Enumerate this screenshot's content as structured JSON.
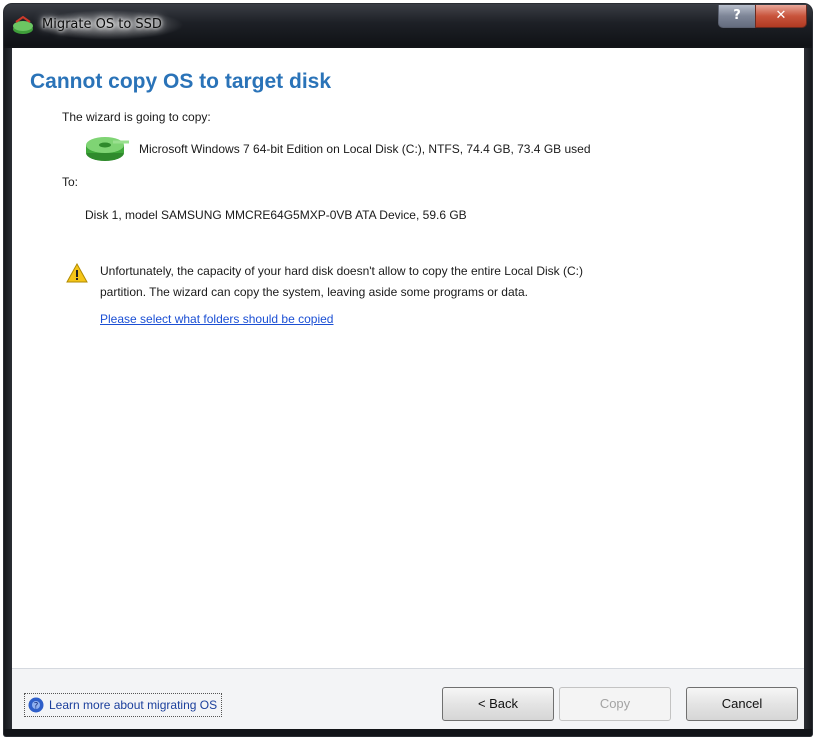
{
  "window": {
    "title": "Migrate OS to SSD",
    "help_label": "?",
    "close_label": "✕"
  },
  "content": {
    "heading": "Cannot copy OS to target disk",
    "intro": "The wizard is going to copy:",
    "source": "Microsoft Windows 7 64-bit Edition on Local Disk (C:), NTFS, 74.4 GB, 73.4 GB used",
    "to_label": "To:",
    "target": "Disk 1, model SAMSUNG MMCRE64G5MXP-0VB ATA Device, 59.6 GB",
    "warning_line1": "Unfortunately, the capacity of your hard disk doesn't allow to copy the entire Local Disk (C:)",
    "warning_line2": "partition. The wizard can copy the system, leaving aside some programs or data.",
    "select_link": "Please select what folders should be copied"
  },
  "footer": {
    "learn_more": "Learn more about migrating OS",
    "back": "< Back",
    "copy": "Copy",
    "cancel": "Cancel"
  },
  "icons": {
    "title": "app-disk-icon",
    "source": "green-disk-icon",
    "warning": "warning-triangle-icon",
    "help": "help-circle-icon"
  },
  "colors": {
    "heading": "#2a73b8",
    "link": "#1b4fd4",
    "frame": "#121418"
  }
}
